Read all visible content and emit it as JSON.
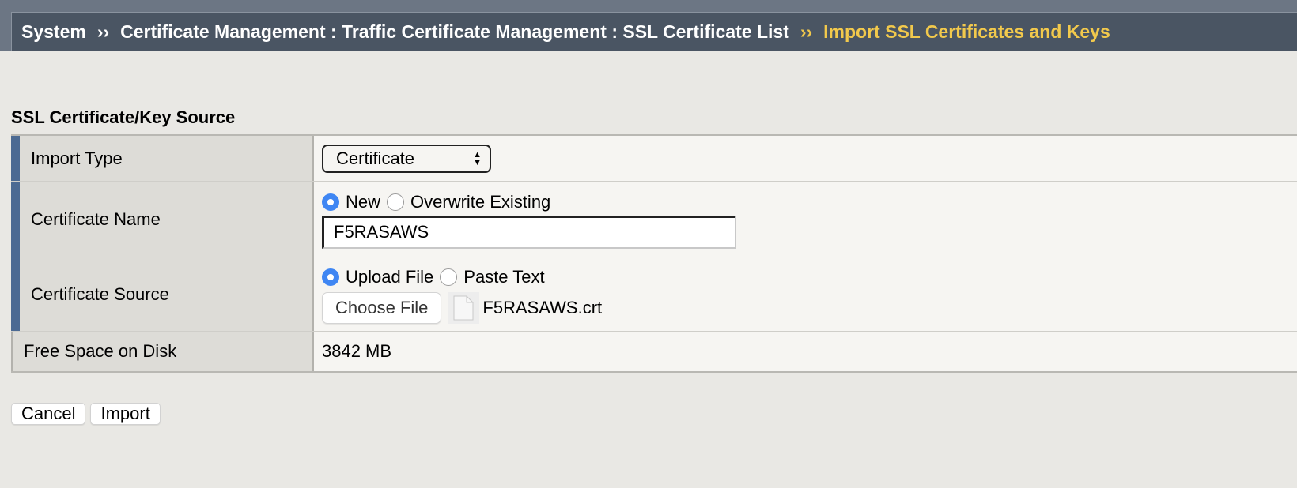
{
  "breadcrumb": {
    "items": [
      "System",
      "Certificate Management : Traffic Certificate Management : SSL Certificate List",
      "Import SSL Certificates and Keys"
    ],
    "separator": "››"
  },
  "section": {
    "title": "SSL Certificate/Key Source"
  },
  "form": {
    "import_type": {
      "label": "Import Type",
      "value": "Certificate"
    },
    "certificate_name": {
      "label": "Certificate Name",
      "option_new": "New",
      "option_overwrite": "Overwrite Existing",
      "selected": "New",
      "value": "F5RASAWS"
    },
    "certificate_source": {
      "label": "Certificate Source",
      "option_upload": "Upload File",
      "option_paste": "Paste Text",
      "selected": "Upload File",
      "choose_file_label": "Choose File",
      "file_name": "F5RASAWS.crt"
    },
    "free_space": {
      "label": "Free Space on Disk",
      "value": "3842 MB"
    }
  },
  "buttons": {
    "cancel": "Cancel",
    "import": "Import"
  },
  "colors": {
    "header_bar": "#4a5563",
    "active_crumb": "#f2c94c",
    "required_marker": "#4c6a93",
    "radio_selected": "#3f86f3"
  }
}
